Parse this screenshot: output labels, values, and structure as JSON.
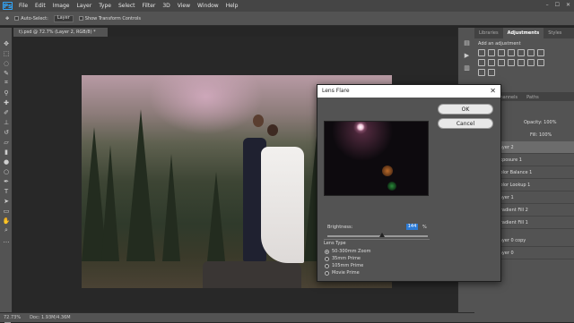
{
  "app": {
    "logo": "Ps"
  },
  "menu": [
    "File",
    "Edit",
    "Image",
    "Layer",
    "Type",
    "Select",
    "Filter",
    "3D",
    "View",
    "Window",
    "Help"
  ],
  "options_bar": {
    "auto_select_label": "Auto-Select:",
    "auto_select_value": "Layer",
    "transform_label": "Show Transform Controls"
  },
  "document_tab": "t).psd @ 72.7% (Layer 2, RGB/8) *",
  "status_bar": {
    "zoom": "72.73%",
    "doc": "Doc: 1.93M/4.36M"
  },
  "panels": {
    "tabs": [
      "Libraries",
      "Adjustments",
      "Styles"
    ],
    "adjustments_title": "Add an adjustment",
    "layers_tabs": [
      "Channels",
      "Paths"
    ],
    "opacity_label": "Opacity:",
    "opacity_value": "100%",
    "fill_label": "Fill:",
    "fill_value": "100%",
    "layers": [
      "Layer 2",
      "Exposure 1",
      "Color Balance 1",
      "Color Lookup 1",
      "Layer 1",
      "Gradient Fill 2",
      "Gradient Fill 1",
      "Layer 0 copy",
      "Layer 0"
    ]
  },
  "dialog": {
    "title": "Lens Flare",
    "ok": "OK",
    "cancel": "Cancel",
    "brightness_label": "Brightness:",
    "brightness_value": "144",
    "brightness_unit": "%",
    "brightness_level": 144,
    "lens_type_label": "Lens Type",
    "lens_types": [
      "50-300mm Zoom",
      "35mm Prime",
      "105mm Prime",
      "Movie Prime"
    ],
    "selected_lens": "50-300mm Zoom"
  }
}
